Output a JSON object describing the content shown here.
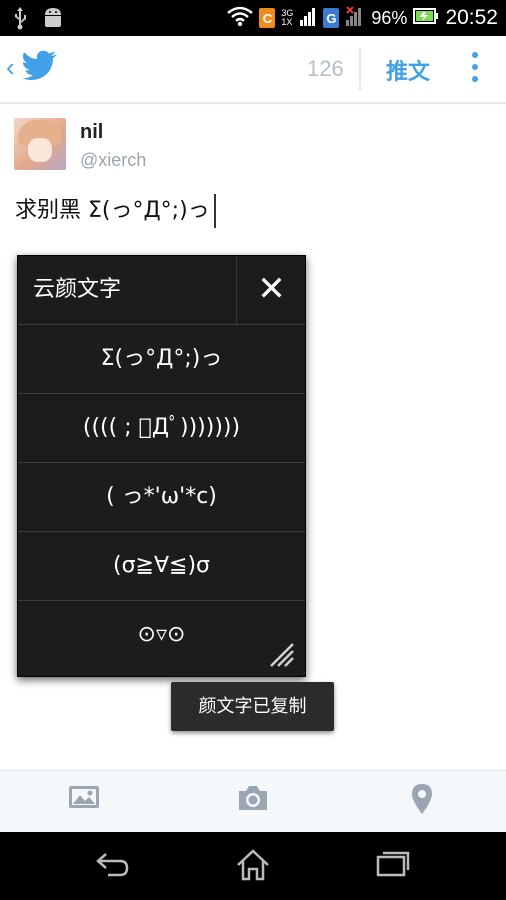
{
  "status_bar": {
    "icons_left": [
      "usb-icon",
      "android-icon"
    ],
    "carrier_badge_1": "C",
    "network_type": "3G",
    "network_sub": "1X",
    "carrier_badge_2": "G",
    "battery_percent": "96%",
    "time": "20:52"
  },
  "header": {
    "back_symbol": "‹",
    "char_count": "126",
    "tweet_button": "推文"
  },
  "compose": {
    "user_name": "nil",
    "user_handle": "@xierch",
    "text": "求别黑 Σ(っ°Д°;)っ"
  },
  "popup": {
    "title": "云颜文字",
    "close_symbol": "✕",
    "items": [
      "Σ(っ°Д°;)っ",
      "((((  ; ﾟДﾟ)))))))",
      "( っ*'ω'*c)",
      "(σ≧∀≦)σ",
      "⊙▿⊙"
    ]
  },
  "toast": {
    "message": "颜文字已复制"
  },
  "toolbar": {
    "icons": [
      "image-icon",
      "camera-icon",
      "location-icon"
    ]
  },
  "navbar": {
    "icons": [
      "back-icon",
      "home-icon",
      "recent-apps-icon"
    ]
  },
  "colors": {
    "accent": "#40a1e6",
    "popup_bg": "#1c1c1c",
    "status_bar_bg": "#000000"
  }
}
